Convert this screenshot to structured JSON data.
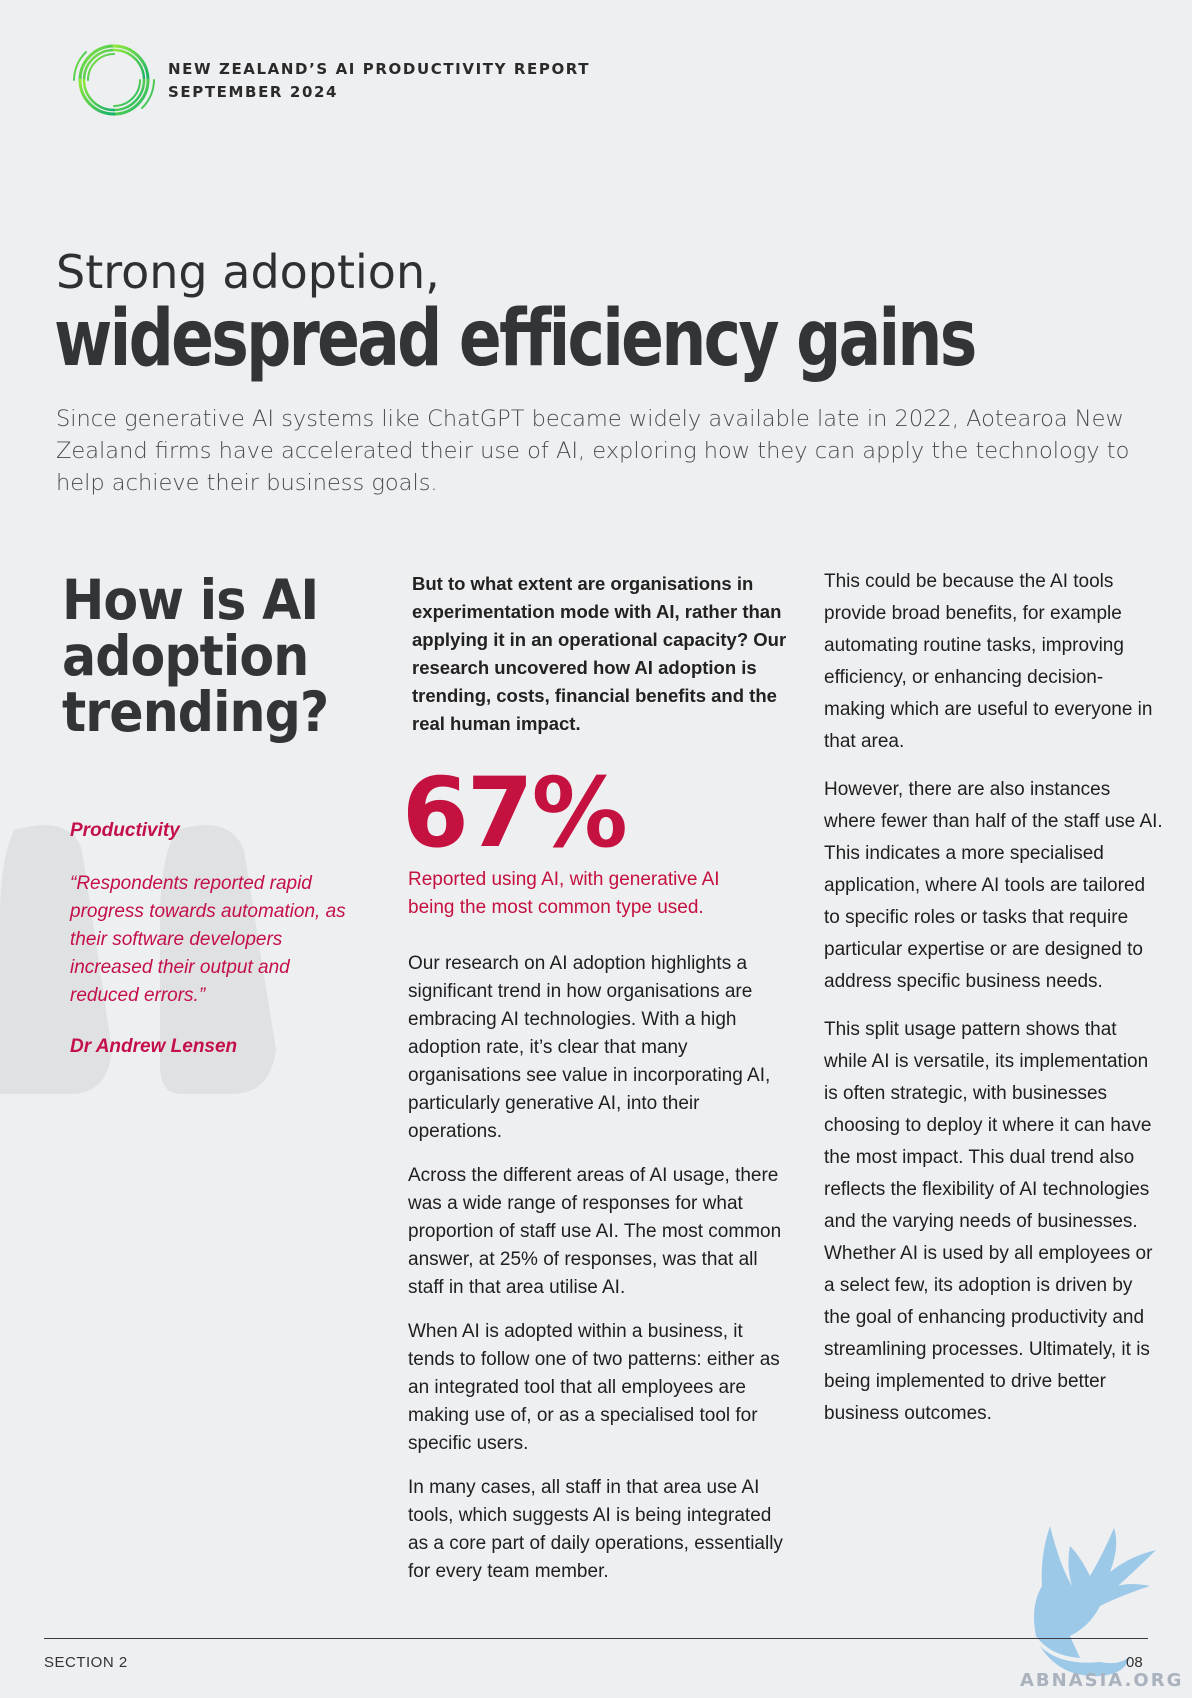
{
  "header": {
    "line1": "NEW ZEALAND’S AI PRODUCTIVITY REPORT",
    "line2": "SEPTEMBER 2024",
    "logo_icon": "ring-logo-icon",
    "logo_colors": [
      "#2ecc40",
      "#8fe83a",
      "#17b26a"
    ]
  },
  "title": {
    "kicker": "Strong adoption,",
    "headline": "widespread efficiency gains"
  },
  "intro": "Since generative AI systems like ChatGPT became widely available late in 2022, Aotearoa New Zealand firms have accelerated their use of AI, exploring how they can apply the technology to help achieve their business goals.",
  "sidebar": {
    "question_lines": [
      "How is AI",
      "adoption",
      "trending?"
    ],
    "quote_label": "Productivity",
    "quote_text": "“Respondents reported rapid progress towards automation, as their software developers increased their output and reduced errors.”",
    "quote_author": "Dr Andrew Lensen"
  },
  "middle": {
    "lead": "But to what extent are organisations in experimentation mode with AI, rather than applying it in an operational capacity? Our research uncovered how AI adoption is trending, costs, financial benefits and the real human impact.",
    "stat_value": "67%",
    "stat_label": "Reported using AI, with generative AI being the most common type used.",
    "paragraphs": [
      "Our research on AI adoption highlights a significant trend in how organisations are embracing AI technologies. With a high adoption rate, it’s clear that many organisations see value in incorporating AI, particularly generative AI, into their operations.",
      "Across the different areas of AI usage, there was a wide range of responses for what proportion of staff use AI. The most common answer, at 25% of responses, was that all staff in that area utilise AI.",
      "When AI is adopted within a business, it tends to follow one of two patterns: either as an integrated tool that all employees are making use of, or as a specialised tool for specific users.",
      "In many cases, all staff in that area use AI tools, which suggests AI is being integrated as a core part of daily operations, essentially for every team member."
    ]
  },
  "right": {
    "paragraphs": [
      "This could be because the AI tools provide broad benefits, for example automating routine tasks, improving efficiency, or enhancing decision-making which are useful to everyone in that area.",
      "However, there are also instances where fewer than half of the staff use AI. This indicates a more specialised application, where AI tools are tailored to specific roles or tasks that require particular expertise or are designed to address specific business needs.",
      "This split usage pattern shows that while AI is versatile, its implementation is often strategic, with businesses choosing to deploy it where it can have the most impact. This dual trend also reflects the flexibility of AI technologies and the varying needs of businesses. Whether AI is used by all employees or a select few, its adoption is driven by the goal of enhancing productivity and streamlining processes. Ultimately, it is being implemented to drive better business outcomes."
    ]
  },
  "footer": {
    "section": "SECTION 2",
    "page": "08"
  },
  "watermark": {
    "text": "ABNASIA.ORG",
    "icon": "griffin-watermark-icon"
  },
  "colors": {
    "accent": "#c5113f",
    "background": "#eeeff1",
    "heading": "#333437"
  }
}
